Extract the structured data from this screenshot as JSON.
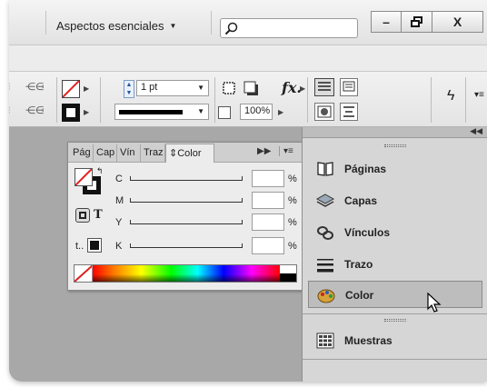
{
  "titlebar": {
    "workspace_label": "Aspectos esenciales",
    "search_placeholder": "",
    "minimize": "–",
    "restore": "⧉",
    "close": "X"
  },
  "controlbar": {
    "stroke_weight": "1 pt",
    "scale_percent": "100%",
    "fx_label": "fx."
  },
  "color_panel": {
    "tabs": [
      "Pág",
      "Cap",
      "Vín",
      "Traz",
      "Color"
    ],
    "active_tab": "Color",
    "sliders": [
      {
        "label": "C",
        "value": "",
        "unit": "%"
      },
      {
        "label": "M",
        "value": "",
        "unit": "%"
      },
      {
        "label": "Y",
        "value": "",
        "unit": "%"
      },
      {
        "label": "K",
        "value": "",
        "unit": "%"
      }
    ],
    "text_mode_label": "T",
    "tint_label": "t.."
  },
  "dock": {
    "items": [
      {
        "label": "Páginas",
        "icon": "pages-icon"
      },
      {
        "label": "Capas",
        "icon": "layers-icon"
      },
      {
        "label": "Vínculos",
        "icon": "links-icon"
      },
      {
        "label": "Trazo",
        "icon": "stroke-icon"
      },
      {
        "label": "Color",
        "icon": "color-palette-icon",
        "selected": true
      },
      {
        "label": "Muestras",
        "icon": "swatches-icon"
      }
    ]
  },
  "colors": {
    "canvas": "#a8a8a8",
    "none_slash": "#e02020"
  }
}
